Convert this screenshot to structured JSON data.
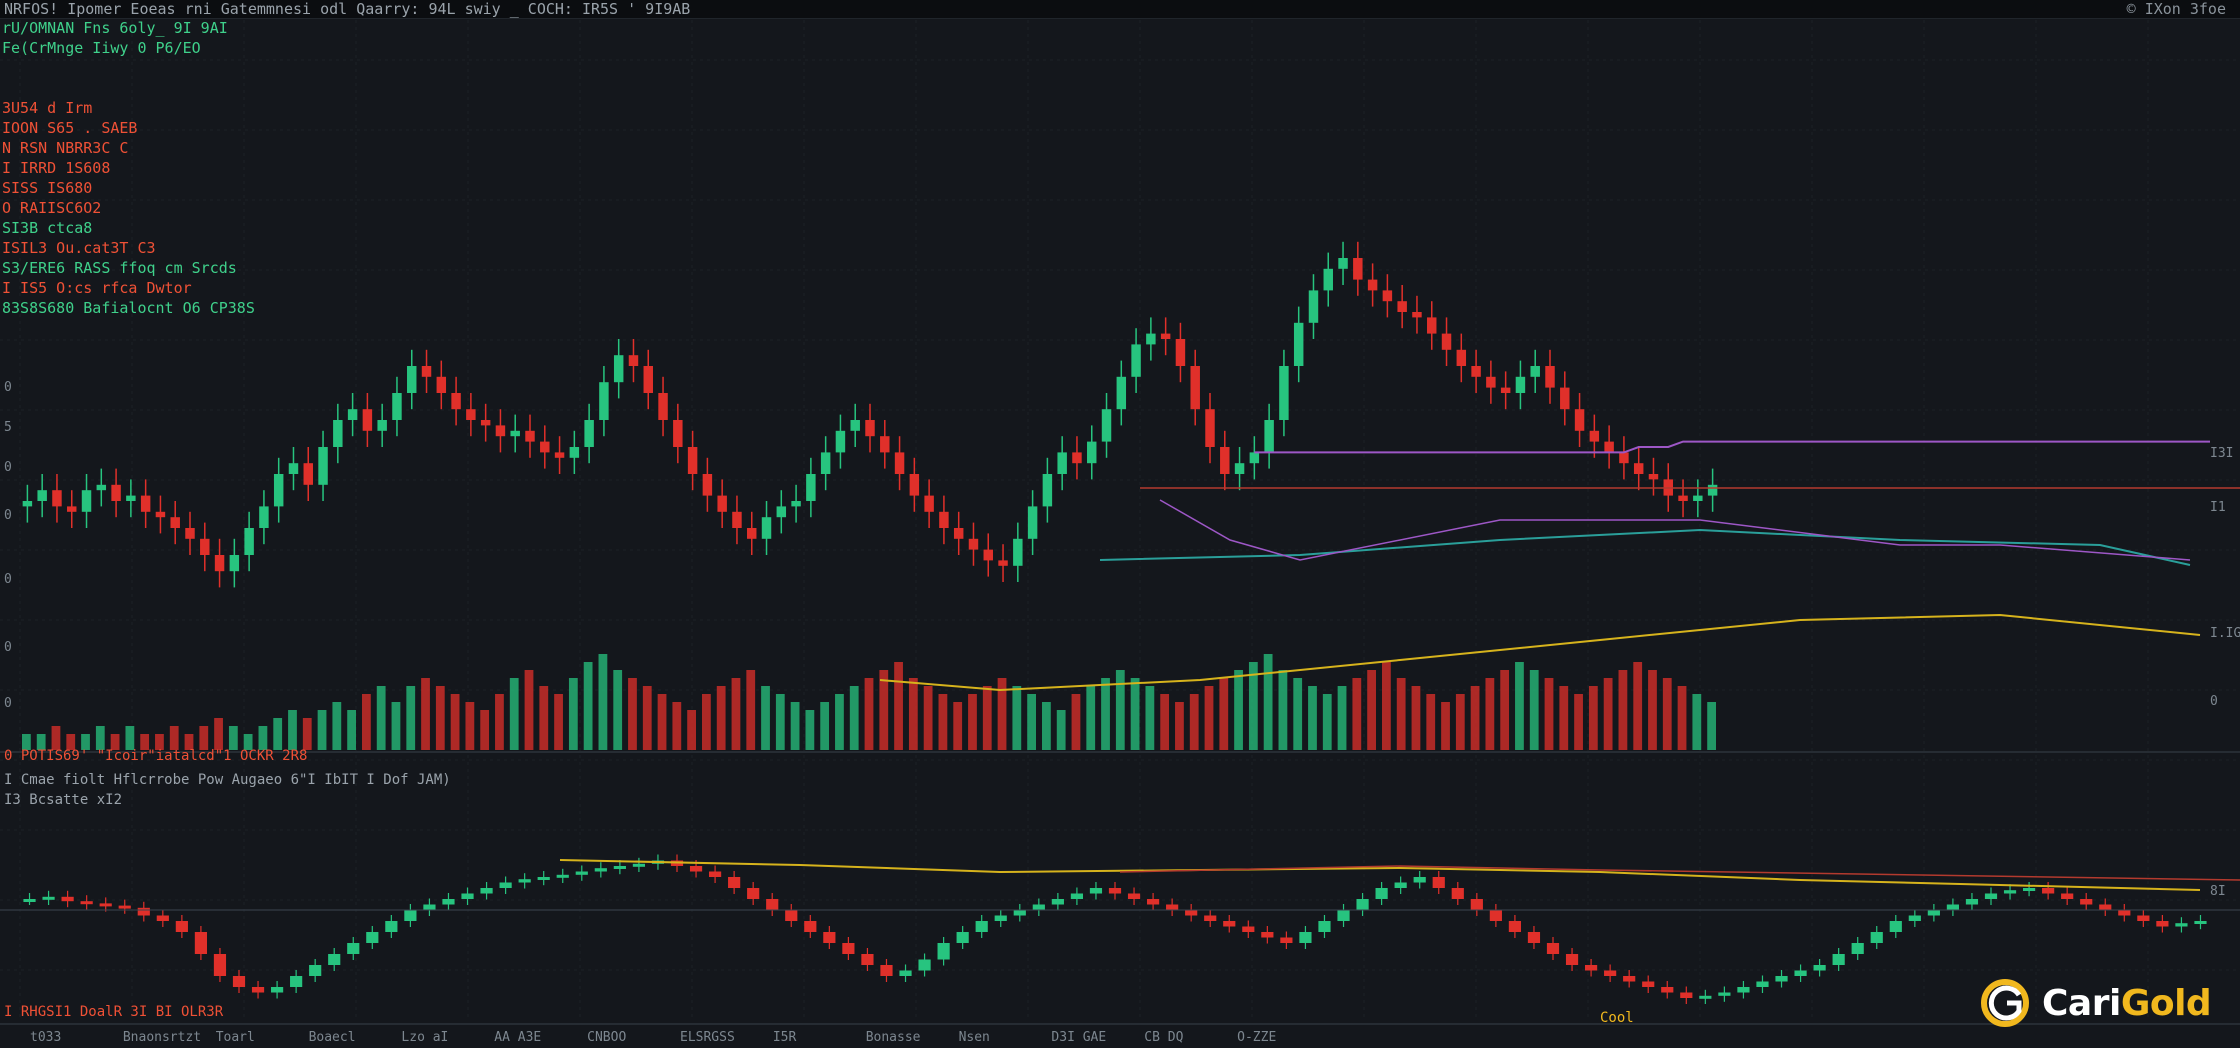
{
  "header": {
    "title": "NRFOS! Ipomer Eoeas rni Gatemmnesi odl Qaarry: 94L swiy _ COCH: IR5S ' 9I9AB",
    "right_label": "© IXon 3foe"
  },
  "legend": {
    "rows": [
      {
        "text": "rU/OMNAN Fns  6oly_ 9I 9AI",
        "color": "#3fd18b"
      },
      {
        "text": "Fe(CrMnge Iiwy 0 P6/EO",
        "color": "#3fd18b"
      },
      {
        "text": "",
        "color": ""
      },
      {
        "text": "",
        "color": ""
      },
      {
        "text": "3U54 d Irm",
        "color": "#ef5136"
      },
      {
        "text": "IOON S65 . SAEB",
        "color": "#ef5136"
      },
      {
        "text": "N RSN  NBRR3C C",
        "color": "#ef5136"
      },
      {
        "text": "I IRRD 1S608",
        "color": "#ef5136"
      },
      {
        "text": "SISS  IS680",
        "color": "#ef5136"
      },
      {
        "text": "O RAIISC6O2",
        "color": "#ef5136"
      },
      {
        "text": "SI3B  ctca8",
        "color": "#3fd18b"
      },
      {
        "text": "ISIL3  Ou.cat3T C3",
        "color": "#ef5136"
      },
      {
        "text": "S3/ERE6  RASS  ffoq  cm Srcds",
        "color": "#3fd18b"
      },
      {
        "text": "I IS5  O:cs  rfca Dwtor",
        "color": "#ef5136"
      },
      {
        "text": "83S8S680  Bafialocnt O6  CP38S",
        "color": "#3fd18b"
      }
    ]
  },
  "panes": {
    "volume_label": "0 POTIS69' \"Icoir\"iatalcd\"1 OCKR 2R8",
    "indicator_title": "I Cmae fiolt Hflcrrobe Pow Augaeo 6\"I IbIT I Dof JAM)",
    "indicator_sub": "I3 Bcsatte xI2",
    "bottom_left": "I RHGSI1 DoalR 3I BI OLR3R",
    "bottom_right": "Cool",
    "right_axis": [
      "I3I",
      "I1",
      "I.IG",
      "0",
      "8I"
    ],
    "left_axis": [
      "0",
      "5",
      "0",
      "0",
      "0",
      "0",
      "0"
    ],
    "bottom_axis": [
      "t033",
      "Bnaonsrtzt",
      "Toarl",
      "Boaecl",
      "Lzo aI",
      "AA  A3E",
      "CNBOO",
      "ELSRGSS",
      "I5R",
      "Bonasse",
      "Nsen",
      "D3I  GAE",
      "CB DQ",
      "O-ZZE"
    ]
  },
  "logo": {
    "word1": "Cari",
    "word2": "Gold"
  },
  "colors": {
    "background": "#14171c",
    "up": "#27c47f",
    "down": "#e0302a",
    "ma_purple": "#9d57c6",
    "ma_yellow": "#d6b31c",
    "ma_teal": "#2a9f9a",
    "ma_red": "#b33a2e",
    "gold": "#f1b81e"
  },
  "chart_data": [
    {
      "type": "candlestick",
      "title": "",
      "description_series": "price",
      "ylim": [
        0,
        100
      ],
      "close": [
        35,
        37,
        34,
        33,
        37,
        38,
        35,
        36,
        33,
        32,
        30,
        28,
        25,
        22,
        25,
        30,
        34,
        40,
        42,
        38,
        45,
        50,
        52,
        48,
        50,
        55,
        60,
        58,
        55,
        52,
        50,
        49,
        47,
        48,
        46,
        44,
        43,
        45,
        50,
        57,
        62,
        60,
        55,
        50,
        45,
        40,
        36,
        33,
        30,
        28,
        32,
        34,
        35,
        40,
        44,
        48,
        50,
        47,
        44,
        40,
        36,
        33,
        30,
        28,
        26,
        24,
        23,
        28,
        34,
        40,
        44,
        42,
        46,
        52,
        58,
        64,
        66,
        65,
        60,
        52,
        45,
        40,
        42,
        44,
        50,
        60,
        68,
        74,
        78,
        80,
        76,
        74,
        72,
        70,
        69,
        66,
        63,
        60,
        58,
        56,
        55,
        58,
        60,
        56,
        52,
        48,
        46,
        44,
        42,
        40,
        39,
        36,
        35,
        36,
        38
      ],
      "ma_purple": [
        null,
        null,
        null,
        null,
        null,
        null,
        null,
        null,
        null,
        null,
        null,
        null,
        null,
        null,
        null,
        null,
        null,
        null,
        null,
        null,
        null,
        null,
        null,
        null,
        null,
        null,
        null,
        null,
        null,
        null,
        null,
        null,
        null,
        null,
        null,
        null,
        null,
        null,
        null,
        null,
        null,
        null,
        null,
        null,
        null,
        null,
        null,
        null,
        null,
        null,
        null,
        null,
        null,
        null,
        null,
        null,
        null,
        null,
        null,
        null,
        null,
        null,
        null,
        null,
        null,
        null,
        null,
        null,
        null,
        null,
        null,
        null,
        null,
        null,
        null,
        null,
        null,
        null,
        null,
        null,
        null,
        null,
        null,
        44,
        44,
        44,
        44,
        44,
        44,
        44,
        44,
        44,
        44,
        44,
        44,
        44,
        44,
        44,
        44,
        44,
        44,
        44,
        44,
        44,
        44,
        44,
        44,
        44,
        44,
        45,
        45,
        45,
        46,
        46,
        46
      ],
      "volume": [
        2,
        2,
        3,
        2,
        2,
        3,
        2,
        3,
        2,
        2,
        3,
        2,
        3,
        4,
        3,
        2,
        3,
        4,
        5,
        4,
        5,
        6,
        5,
        7,
        8,
        6,
        8,
        9,
        8,
        7,
        6,
        5,
        7,
        9,
        10,
        8,
        7,
        9,
        11,
        12,
        10,
        9,
        8,
        7,
        6,
        5,
        7,
        8,
        9,
        10,
        8,
        7,
        6,
        5,
        6,
        7,
        8,
        9,
        10,
        11,
        9,
        8,
        7,
        6,
        7,
        8,
        9,
        8,
        7,
        6,
        5,
        7,
        8,
        9,
        10,
        9,
        8,
        7,
        6,
        7,
        8,
        9,
        10,
        11,
        12,
        10,
        9,
        8,
        7,
        8,
        9,
        10,
        11,
        9,
        8,
        7,
        6,
        7,
        8,
        9,
        10,
        11,
        10,
        9,
        8,
        7,
        8,
        9,
        10,
        11,
        10,
        9,
        8,
        7,
        6
      ]
    },
    {
      "type": "candlestick",
      "title": "",
      "description_series": "oscillator",
      "ylim": [
        -100,
        100
      ],
      "close": [
        10,
        12,
        8,
        6,
        4,
        2,
        -5,
        -10,
        -20,
        -40,
        -60,
        -70,
        -75,
        -70,
        -60,
        -50,
        -40,
        -30,
        -20,
        -10,
        0,
        5,
        10,
        15,
        20,
        25,
        28,
        30,
        32,
        35,
        38,
        40,
        42,
        45,
        40,
        35,
        30,
        20,
        10,
        0,
        -10,
        -20,
        -30,
        -40,
        -50,
        -60,
        -55,
        -45,
        -30,
        -20,
        -10,
        -5,
        0,
        5,
        10,
        15,
        20,
        15,
        10,
        5,
        0,
        -5,
        -10,
        -15,
        -20,
        -25,
        -30,
        -20,
        -10,
        0,
        10,
        20,
        25,
        30,
        20,
        10,
        0,
        -10,
        -20,
        -30,
        -40,
        -50,
        -55,
        -60,
        -65,
        -70,
        -75,
        -80,
        -78,
        -75,
        -70,
        -65,
        -60,
        -55,
        -50,
        -40,
        -30,
        -20,
        -10,
        -5,
        0,
        5,
        10,
        15,
        18,
        20,
        15,
        10,
        5,
        0,
        -5,
        -10,
        -15,
        -12,
        -10
      ]
    }
  ]
}
